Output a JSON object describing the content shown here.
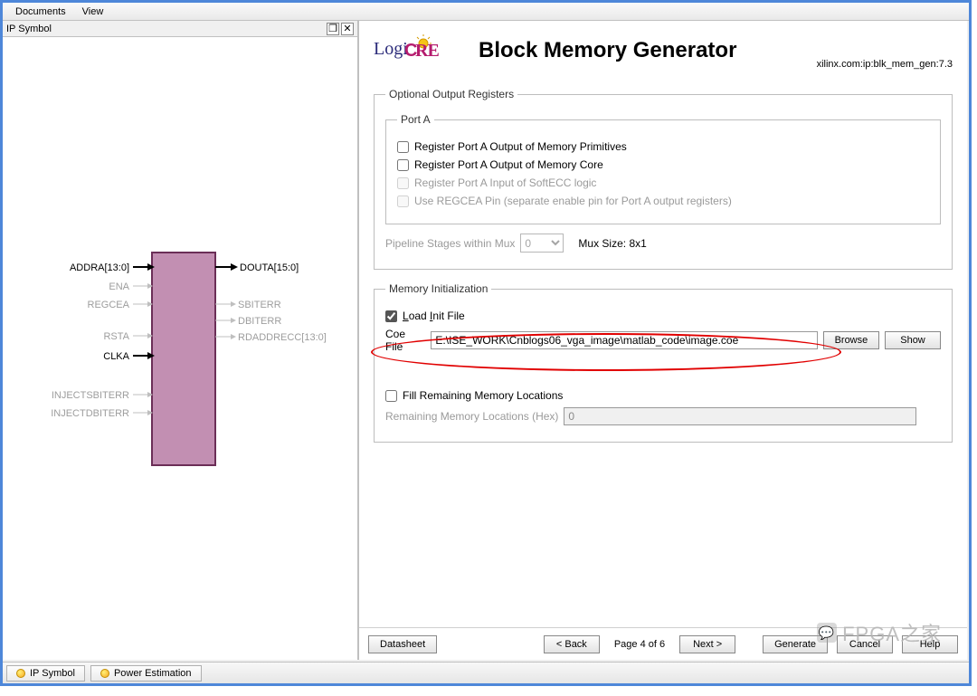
{
  "menubar": {
    "documents": "Documents",
    "view": "View"
  },
  "left": {
    "panel_title": "IP Symbol",
    "tabs": {
      "ip_symbol": "IP Symbol",
      "power_estimation": "Power Estimation"
    },
    "ports": {
      "addra": "ADDRA[13:0]",
      "ena": "ENA",
      "regcea": "REGCEA",
      "rsta": "RSTA",
      "clka": "CLKA",
      "injsbit": "INJECTSBITERR",
      "injdbit": "INJECTDBITERR",
      "douta": "DOUTA[15:0]",
      "sbiterr": "SBITERR",
      "dbiterr": "DBITERR",
      "rdaddrecc": "RDADDRECC[13:0]"
    }
  },
  "header": {
    "title": "Block Memory Generator",
    "vlnv": "xilinx.com:ip:blk_mem_gen:7.3"
  },
  "optreg": {
    "legend": "Optional Output Registers",
    "porta_legend": "Port A",
    "primitives": "Register Port A Output of Memory Primitives",
    "core": "Register Port A Output of Memory Core",
    "softecc": "Register Port A Input of SoftECC logic",
    "regcea": "Use REGCEA Pin (separate enable pin for Port A output registers)",
    "pipeline_label": "Pipeline Stages within Mux",
    "pipeline_value": "0",
    "mux_size": "Mux Size: 8x1"
  },
  "meminit": {
    "legend": "Memory Initialization",
    "load_label": "Load Init File",
    "coe_label": "Coe File",
    "coe_path": "E:\\ISE_WORK\\Cnblogs06_vga_image\\matlab_code\\image.coe",
    "browse": "Browse",
    "show": "Show",
    "fill_label": "Fill Remaining Memory Locations",
    "remaining_label": "Remaining Memory Locations (Hex)",
    "remaining_value": "0"
  },
  "footer": {
    "datasheet": "Datasheet",
    "back": "< Back",
    "page": "Page 4 of 6",
    "next": "Next >",
    "generate": "Generate",
    "cancel": "Cancel",
    "help": "Help"
  },
  "watermark": "FPGA之家"
}
